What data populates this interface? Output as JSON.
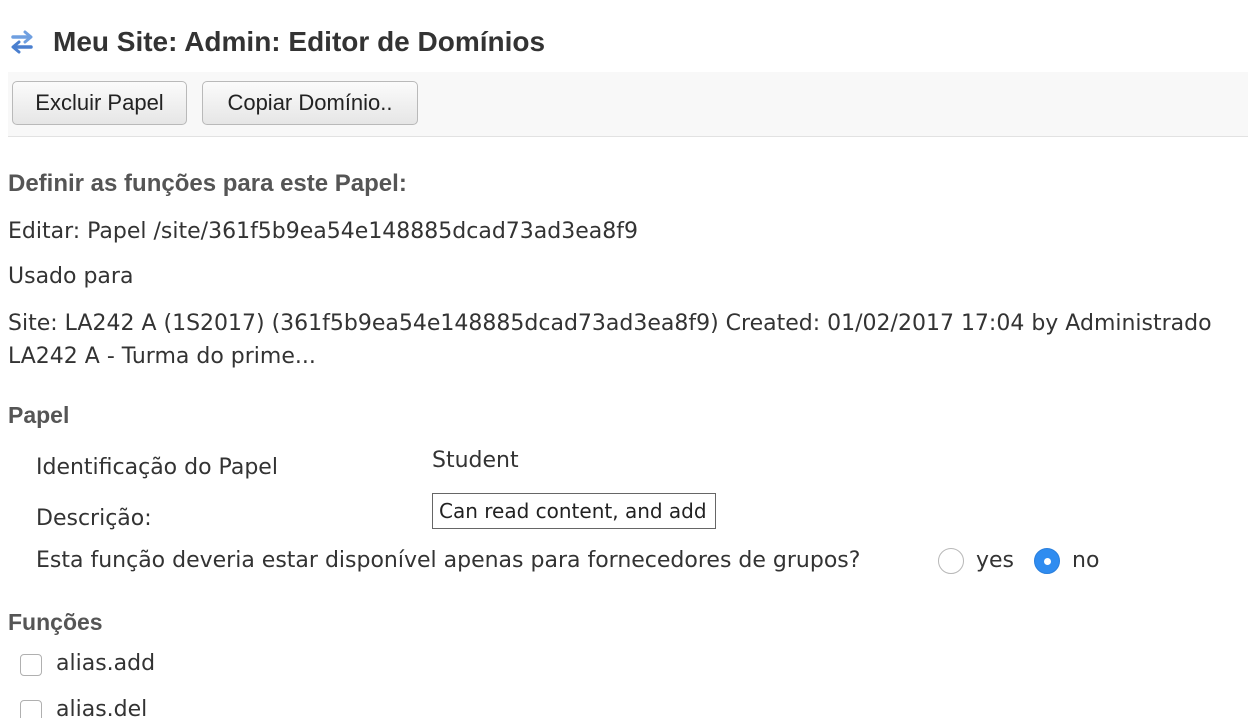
{
  "header": {
    "icon": "swap-arrows-icon",
    "title": "Meu Site: Admin: Editor de Domínios"
  },
  "toolbar": {
    "delete_label": "Excluir Papel",
    "copy_label": "Copiar Domínio.."
  },
  "functions_heading": "Definir as funções para este Papel:",
  "edit_line": "Editar: Papel /site/361f5b9ea54e148885dcad73ad3ea8f9",
  "used_for_label": "Usado para",
  "site_line_1": "Site: LA242 A (1S2017) (361f5b9ea54e148885dcad73ad3ea8f9) Created: 01/02/2017 17:04 by Administrado",
  "site_line_2": "LA242 A - Turma do prime...",
  "role": {
    "heading": "Papel",
    "id_label": "Identificação do Papel",
    "id_value": "Student",
    "description_label": "Descrição:",
    "description_value": "Can read content, and add",
    "provider_question": "Esta função deveria estar disponível apenas para fornecedores de grupos?",
    "option_yes": "yes",
    "option_no": "no",
    "selected": "no"
  },
  "functions": {
    "heading": "Funções",
    "items": [
      {
        "label": "alias.add",
        "checked": false
      },
      {
        "label": "alias.del",
        "checked": false
      }
    ]
  },
  "colors": {
    "radio_selected": "#2f8cf0",
    "icon_blue": "#5b8fd6"
  }
}
